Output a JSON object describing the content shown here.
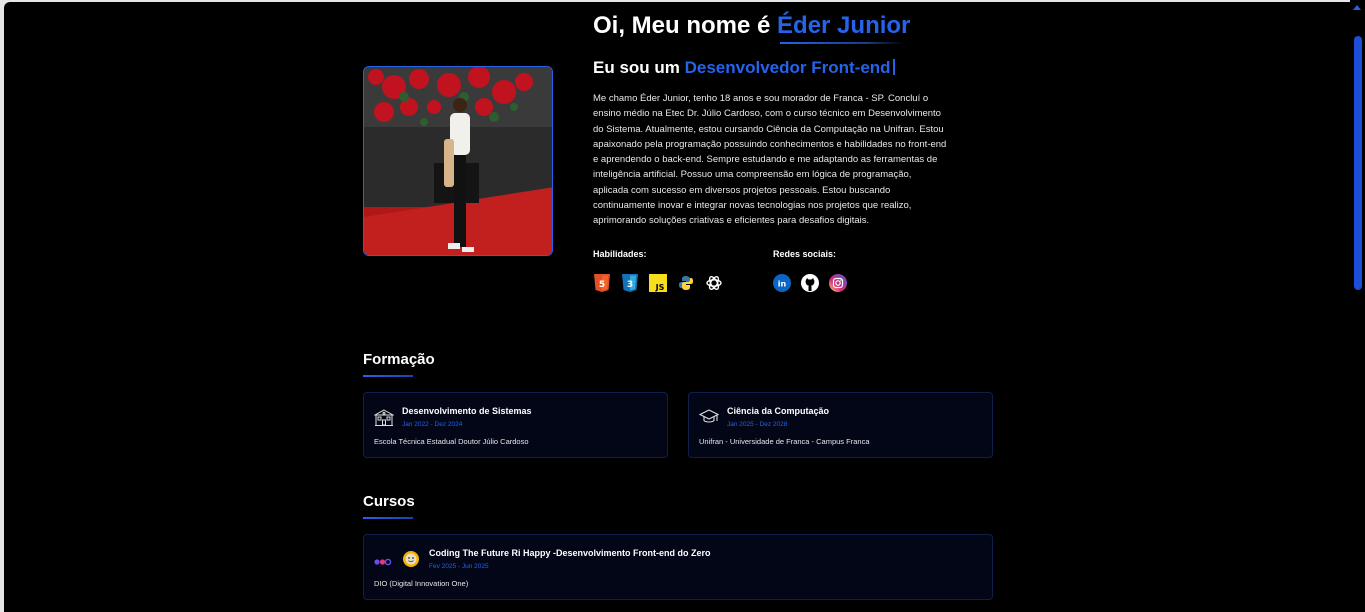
{
  "hero": {
    "greeting": "Oi, Meu nome é ",
    "name": "Éder Junior",
    "role_prefix": "Eu sou um ",
    "role": "Desenvolvedor Front-end",
    "bio": "Me chamo Éder Junior, tenho 18 anos e sou morador de Franca - SP. Concluí o ensino médio na Etec Dr. Júlio Cardoso, com o curso técnico em Desenvolvimento do Sistema. Atualmente, estou cursando Ciência da Computação na Unifran. Estou apaixonado pela programação possuindo conhecimentos e habilidades no front-end e aprendendo o back-end. Sempre estudando e me adaptando as ferramentas de inteligência artificial. Possuo uma compreensão em lógica de programação, aplicada com sucesso em diversos projetos pessoais. Estou buscando continuamente inovar e integrar novas tecnologias nos projetos que realizo, aprimorando soluções criativas e eficientes para desafios digitais.",
    "photo_icon": "profile-photo"
  },
  "skills": {
    "label": "Habilidades:",
    "items": [
      "html5-icon",
      "css3-icon",
      "javascript-icon",
      "python-icon",
      "openai-icon"
    ]
  },
  "social": {
    "label": "Redes sociais:",
    "items": [
      "linkedin-icon",
      "github-icon",
      "instagram-icon"
    ]
  },
  "education": {
    "title": "Formação",
    "items": [
      {
        "title": "Desenvolvimento de Sistemas",
        "date": "Jan 2022 - Dez 2024",
        "school": "Escola Técnica Estadual Doutor Júlio Cardoso",
        "icon": "school-building-icon"
      },
      {
        "title": "Ciência da Computação",
        "date": "Jan 2025 - Dez 2028",
        "school": "Unifran - Universidade de Franca - Campus Franca",
        "icon": "graduation-cap-icon"
      }
    ]
  },
  "courses": {
    "title": "Cursos",
    "items": [
      {
        "title": "Coding The Future Ri Happy -Desenvolvimento Front-end do Zero",
        "date": "Fev 2025 - Jun 2025",
        "school": "DIO (Digital Innovation One)",
        "icons": [
          "dio-logo-icon",
          "ri-happy-logo-icon"
        ]
      }
    ]
  },
  "colors": {
    "accent": "#2563eb",
    "background": "#000000",
    "card": "#020617"
  }
}
